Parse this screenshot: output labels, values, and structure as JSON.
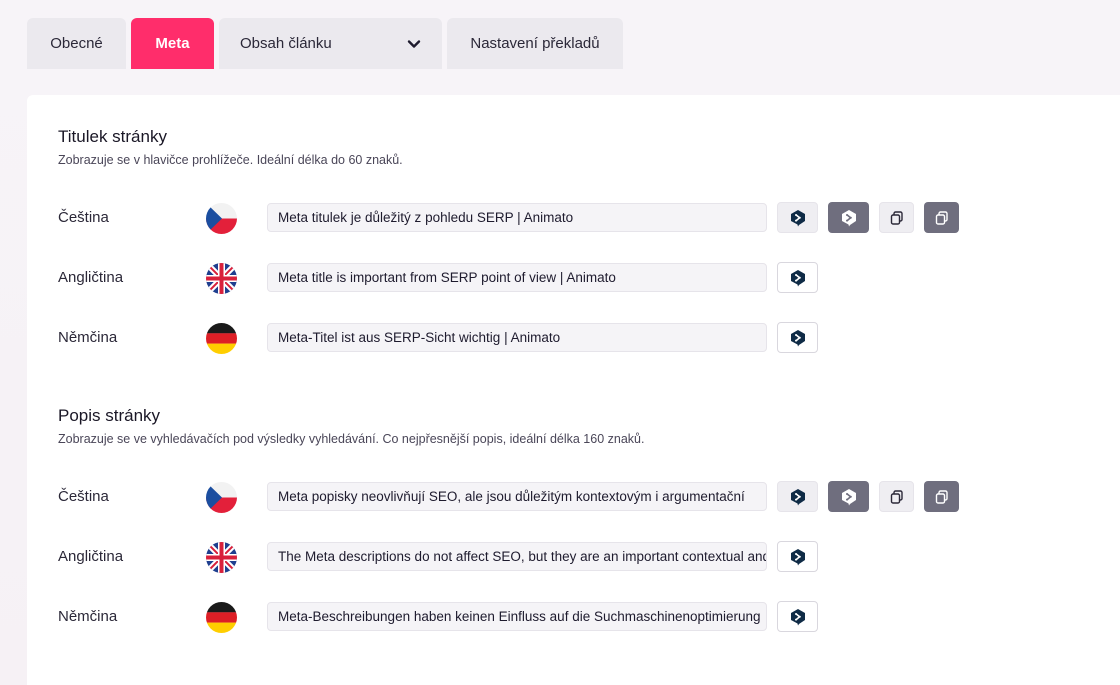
{
  "tabs": {
    "general": "Obecné",
    "meta": "Meta",
    "content": "Obsah článku",
    "translations": "Nastavení překladů"
  },
  "colors": {
    "accent": "#ff2d6b",
    "tab_bg": "#ebe9ee",
    "dark_button": "#6f6e7e"
  },
  "title_section": {
    "heading": "Titulek stránky",
    "description": "Zobrazuje se v hlavičce prohlížeče. Ideální délka do 60 znaků.",
    "rows": [
      {
        "lang": "Čeština",
        "flag": "cz-flag-icon",
        "value": "Meta titulek je důležitý z pohledu SERP | Animato"
      },
      {
        "lang": "Angličtina",
        "flag": "uk-flag-icon",
        "value": "Meta title is important from SERP point of view | Animato"
      },
      {
        "lang": "Němčina",
        "flag": "de-flag-icon",
        "value": "Meta-Titel ist aus SERP-Sicht wichtig | Animato"
      }
    ]
  },
  "description_section": {
    "heading": "Popis stránky",
    "description": "Zobrazuje se ve vyhledávačích pod výsledky vyhledávání. Co nejpřesnější popis, ideální délka 160 znaků.",
    "rows": [
      {
        "lang": "Čeština",
        "flag": "cz-flag-icon",
        "value": "Meta popisky neovlivňují SEO, ale jsou důležitým kontextovým  i argumentační"
      },
      {
        "lang": "Angličtina",
        "flag": "uk-flag-icon",
        "value": "The Meta descriptions do not affect SEO, but they are an important contextual and"
      },
      {
        "lang": "Němčina",
        "flag": "de-flag-icon",
        "value": "Meta-Beschreibungen haben keinen Einfluss auf die Suchmaschinenoptimierung"
      }
    ]
  },
  "icons": {
    "translate": "deepl-translate-icon",
    "translate_all": "deepl-translate-all-icon",
    "copy": "copy-icon",
    "copy_all": "copy-all-icon",
    "dropdown": "chevron-down-icon"
  }
}
